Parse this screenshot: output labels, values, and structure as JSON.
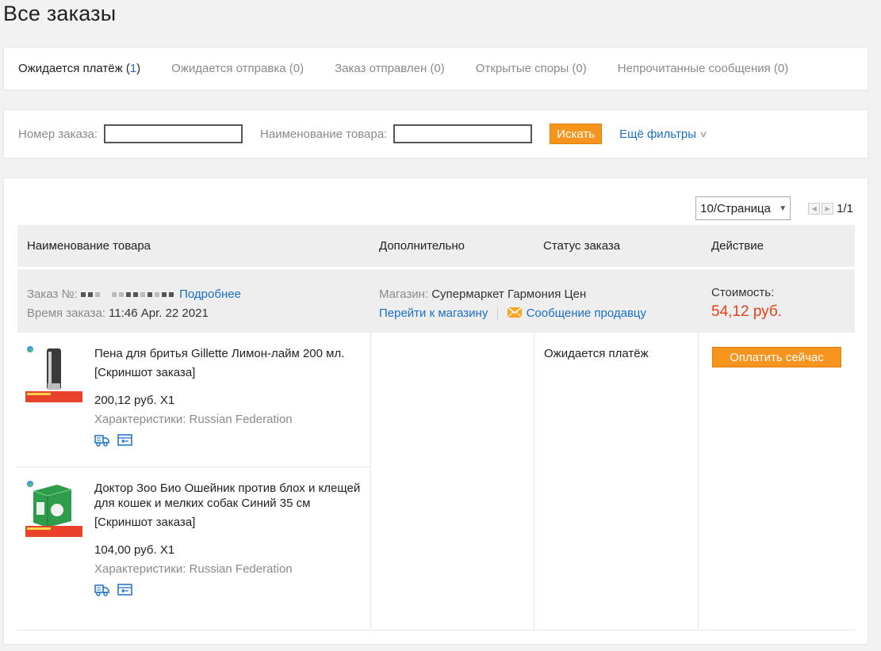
{
  "page": {
    "title": "Все заказы"
  },
  "tabs": [
    {
      "label": "Ожидается платёж (",
      "count": "1",
      "suffix": ")"
    },
    {
      "label": "Ожидается отправка (0)"
    },
    {
      "label": "Заказ отправлен (0)"
    },
    {
      "label": "Открытые споры (0)"
    },
    {
      "label": "Непрочитанные сообщения (0)"
    }
  ],
  "filters": {
    "order_number_label": "Номер заказа:",
    "order_number_value": "",
    "product_name_label": "Наименование товара:",
    "product_name_value": "",
    "search_label": "Искать",
    "more_filters_label": "Ещё фильтры"
  },
  "pagination": {
    "page_size": "10/Страница",
    "page_count": "1/1"
  },
  "table": {
    "headers": [
      "Наименование товара",
      "Дополнительно",
      "Статус заказа",
      "Действие"
    ]
  },
  "order": {
    "number_label": "Заказ №:",
    "details_link": "Подробнее",
    "time_label": "Время заказа:",
    "time_value": "11:46 Apr. 22 2021",
    "store_label": "Магазин:",
    "store_name": "Супермаркет Гармония Цен",
    "go_to_store": "Перейти к магазину",
    "separator": "|",
    "message_seller": "Сообщение продавцу",
    "cost_label": "Стоимость:",
    "cost_value": "54,12 руб.",
    "status": "Ожидается платёж",
    "pay_button": "Оплатить сейчас",
    "accent_color": "#f7941e",
    "price_color": "#e0431b"
  },
  "items": [
    {
      "title": "Пена для бритья Gillette Лимон-лайм 200 мл.",
      "snapshot": "[Скриншот заказа]",
      "price_qty": "200,12 руб. X1",
      "props": "Характеристики: Russian Federation",
      "icons": [
        "delivery-truck-icon",
        "return-icon"
      ]
    },
    {
      "title": "Доктор Зоо Био Ошейник против блох и клещей для кошек и мелких собак Синий 35 см",
      "snapshot": "[Скриншот заказа]",
      "price_qty": "104,00 руб. X1",
      "props": "Характеристики: Russian Federation",
      "icons": [
        "delivery-truck-icon",
        "return-icon"
      ]
    }
  ]
}
